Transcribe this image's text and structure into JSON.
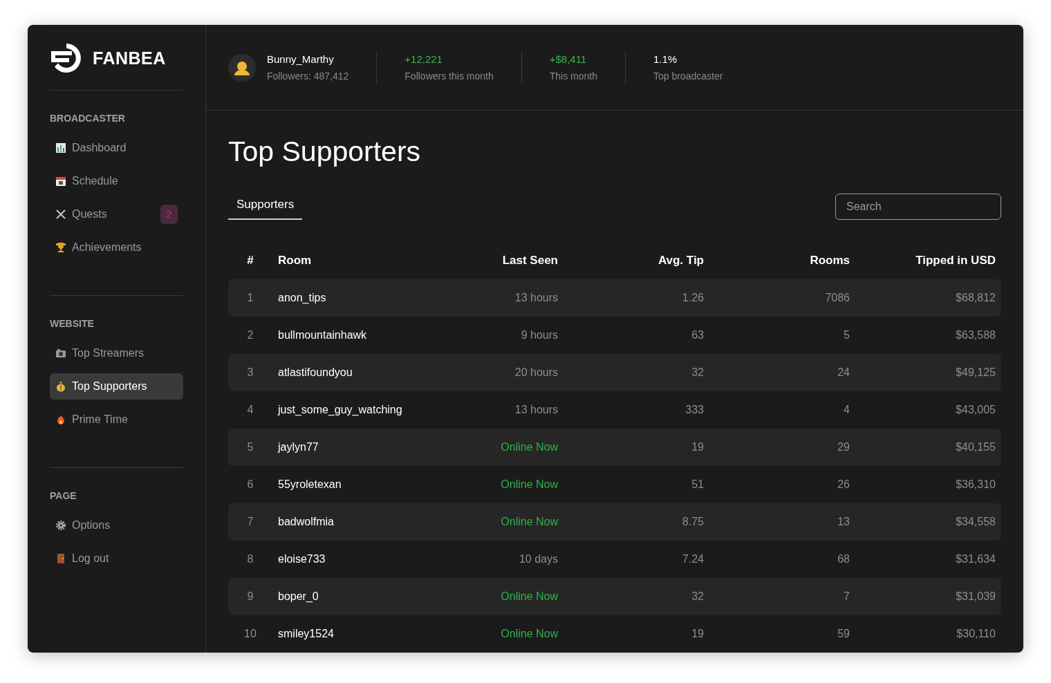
{
  "brand": {
    "name": "FANBEA"
  },
  "sidebar": {
    "sections": [
      {
        "title": "BROADCASTER",
        "items": [
          {
            "label": "Dashboard",
            "selected": false
          },
          {
            "label": "Schedule",
            "selected": false
          },
          {
            "label": "Quests",
            "selected": false,
            "badge": "2"
          },
          {
            "label": "Achievements",
            "selected": false
          }
        ]
      },
      {
        "title": "WEBSITE",
        "items": [
          {
            "label": "Top Streamers",
            "selected": false
          },
          {
            "label": "Top Supporters",
            "selected": true
          },
          {
            "label": "Prime Time",
            "selected": false
          }
        ]
      },
      {
        "title": "PAGE",
        "items": [
          {
            "label": "Options",
            "selected": false
          },
          {
            "label": "Log out",
            "selected": false
          }
        ]
      }
    ]
  },
  "profile": {
    "name": "Bunny_Marthy",
    "followers": "Followers: 487,412"
  },
  "stats": [
    {
      "value": "+12,221",
      "label": "Followers this month",
      "positive": true
    },
    {
      "value": "+$8,411",
      "label": "This month",
      "positive": true
    },
    {
      "value": "1.1%",
      "label": "Top broadcaster",
      "positive": false
    }
  ],
  "page_title": "Top Supporters",
  "tabs": [
    {
      "label": "Supporters",
      "selected": true
    }
  ],
  "search": {
    "placeholder": "Search"
  },
  "table": {
    "columns": [
      "#",
      "Room",
      "Last Seen",
      "Avg. Tip",
      "Rooms",
      "Tipped in USD"
    ],
    "rows": [
      {
        "rank": "1",
        "room": "anon_tips",
        "last_seen": "13 hours",
        "online": false,
        "avg_tip": "1.26",
        "rooms": "7086",
        "tipped": "$68,812"
      },
      {
        "rank": "2",
        "room": "bullmountainhawk",
        "last_seen": "9 hours",
        "online": false,
        "avg_tip": "63",
        "rooms": "5",
        "tipped": "$63,588"
      },
      {
        "rank": "3",
        "room": "atlastifoundyou",
        "last_seen": "20 hours",
        "online": false,
        "avg_tip": "32",
        "rooms": "24",
        "tipped": "$49,125"
      },
      {
        "rank": "4",
        "room": "just_some_guy_watching",
        "last_seen": "13 hours",
        "online": false,
        "avg_tip": "333",
        "rooms": "4",
        "tipped": "$43,005"
      },
      {
        "rank": "5",
        "room": "jaylyn77",
        "last_seen": "Online Now",
        "online": true,
        "avg_tip": "19",
        "rooms": "29",
        "tipped": "$40,155"
      },
      {
        "rank": "6",
        "room": "55yroletexan",
        "last_seen": "Online Now",
        "online": true,
        "avg_tip": "51",
        "rooms": "26",
        "tipped": "$36,310"
      },
      {
        "rank": "7",
        "room": "badwolfmia",
        "last_seen": "Online Now",
        "online": true,
        "avg_tip": "8.75",
        "rooms": "13",
        "tipped": "$34,558"
      },
      {
        "rank": "8",
        "room": "eloise733",
        "last_seen": "10 days",
        "online": false,
        "avg_tip": "7.24",
        "rooms": "68",
        "tipped": "$31,634"
      },
      {
        "rank": "9",
        "room": "boper_0",
        "last_seen": "Online Now",
        "online": true,
        "avg_tip": "32",
        "rooms": "7",
        "tipped": "$31,039"
      },
      {
        "rank": "10",
        "room": "smiley1524",
        "last_seen": "Online Now",
        "online": true,
        "avg_tip": "19",
        "rooms": "59",
        "tipped": "$30,110"
      }
    ]
  }
}
